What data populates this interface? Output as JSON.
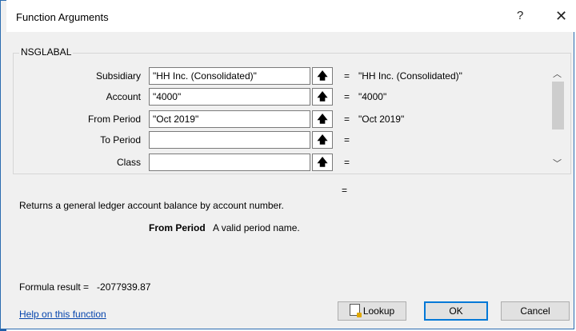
{
  "window": {
    "title": "Function Arguments",
    "help_symbol": "?",
    "close_symbol": "✕"
  },
  "function": {
    "name": "NSGLABAL",
    "arguments": [
      {
        "label": "Subsidiary",
        "value": "\"HH Inc. (Consolidated)\"",
        "equals": "=",
        "result": "\"HH Inc. (Consolidated)\""
      },
      {
        "label": "Account",
        "value": "\"4000\"",
        "equals": "=",
        "result": "\"4000\""
      },
      {
        "label": "From Period",
        "value": "\"Oct 2019\"",
        "equals": "=",
        "result": "\"Oct 2019\""
      },
      {
        "label": "To Period",
        "value": "",
        "equals": "=",
        "result": ""
      },
      {
        "label": "Class",
        "value": "",
        "equals": "=",
        "result": ""
      }
    ],
    "overall_equals": "=",
    "description": "Returns a general ledger account balance by account number.",
    "param_name": "From Period",
    "param_desc": "A valid period name."
  },
  "formula_result_label": "Formula result =",
  "formula_result_value": "-2077939.87",
  "help_link": "Help on this function",
  "buttons": {
    "lookup": "Lookup",
    "ok": "OK",
    "cancel": "Cancel"
  },
  "icons": {
    "ref_button": "range-select-icon",
    "scroll_up": "chevron-up-icon",
    "scroll_down": "chevron-down-icon"
  },
  "colors": {
    "accent": "#1f5fa8",
    "link": "#0645ad",
    "ok_border": "#0078d7"
  }
}
